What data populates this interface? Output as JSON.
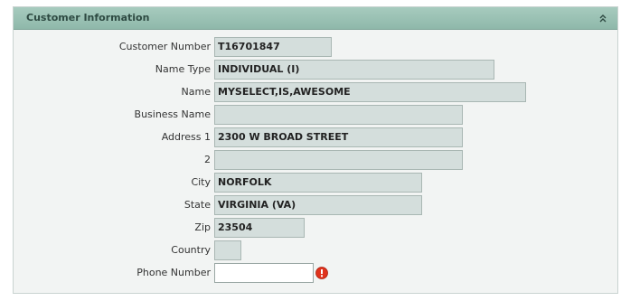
{
  "panel": {
    "title": "Customer Information"
  },
  "fields": [
    {
      "label": "Customer Number",
      "value": "T16701847"
    },
    {
      "label": "Name Type",
      "value": "INDIVIDUAL (I)"
    },
    {
      "label": "Name",
      "value": "MYSELECT,IS,AWESOME"
    },
    {
      "label": "Business Name",
      "value": ""
    },
    {
      "label": "Address 1",
      "value": "2300 W BROAD STREET"
    },
    {
      "label": "2",
      "value": ""
    },
    {
      "label": "City",
      "value": "NORFOLK"
    },
    {
      "label": "State",
      "value": "VIRGINIA (VA)"
    },
    {
      "label": "Zip",
      "value": "23504"
    },
    {
      "label": "Country",
      "value": ""
    },
    {
      "label": "Phone Number",
      "value": ""
    }
  ],
  "icons": {
    "collapse": "double-chevron-up-icon",
    "error": "error-icon"
  },
  "colors": {
    "header": "#9cc2b4",
    "field_readonly": "#d4dedc",
    "error": "#e0321c"
  }
}
